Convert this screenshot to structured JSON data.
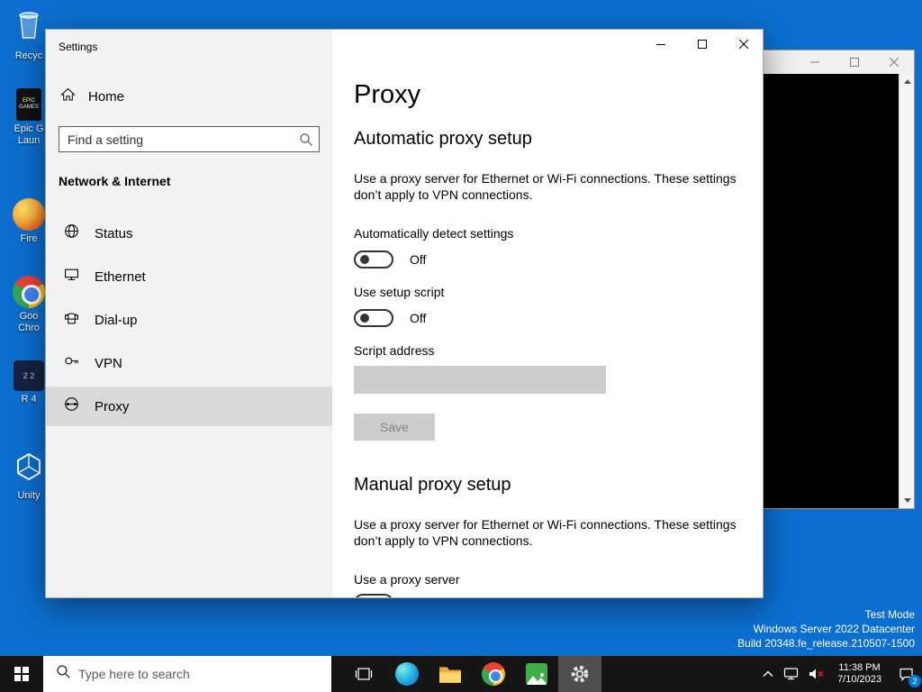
{
  "desktop": {
    "icons": [
      {
        "name": "recycle-bin",
        "label": "Recyc"
      },
      {
        "name": "epic-games-launcher",
        "label": "Epic G",
        "label2": "Laun",
        "icon_text1": "EPIC",
        "icon_text2": "GAMES"
      },
      {
        "name": "firefox",
        "label": "Fire"
      },
      {
        "name": "google-chrome",
        "label": "Goo",
        "label2": "Chro"
      },
      {
        "name": "r-app",
        "label": "R 4"
      },
      {
        "name": "unity",
        "label": "Unity"
      }
    ],
    "watermark": {
      "line1": "Test Mode",
      "line2": "Windows Server 2022 Datacenter",
      "line3": "Build 20348.fe_release.210507-1500"
    }
  },
  "settings_window": {
    "title": "Settings",
    "sidebar": {
      "home_label": "Home",
      "search_placeholder": "Find a setting",
      "section_header": "Network & Internet",
      "items": [
        {
          "label": "Status"
        },
        {
          "label": "Ethernet"
        },
        {
          "label": "Dial-up"
        },
        {
          "label": "VPN"
        },
        {
          "label": "Proxy"
        }
      ]
    },
    "main": {
      "page_title": "Proxy",
      "auto": {
        "heading": "Automatic proxy setup",
        "description": "Use a proxy server for Ethernet or Wi-Fi connections. These settings\ndon’t apply to VPN connections.",
        "detect_label": "Automatically detect settings",
        "detect_state": "Off",
        "script_label": "Use setup script",
        "script_state": "Off",
        "address_label": "Script address",
        "save_label": "Save"
      },
      "manual": {
        "heading": "Manual proxy setup",
        "description": "Use a proxy server for Ethernet or Wi-Fi connections. These settings\ndon’t apply to VPN connections.",
        "proxy_label": "Use a proxy server"
      }
    }
  },
  "taskbar": {
    "search_placeholder": "Type here to search",
    "time": "11:38 PM",
    "date": "7/10/2023",
    "notification_badge": "2"
  }
}
